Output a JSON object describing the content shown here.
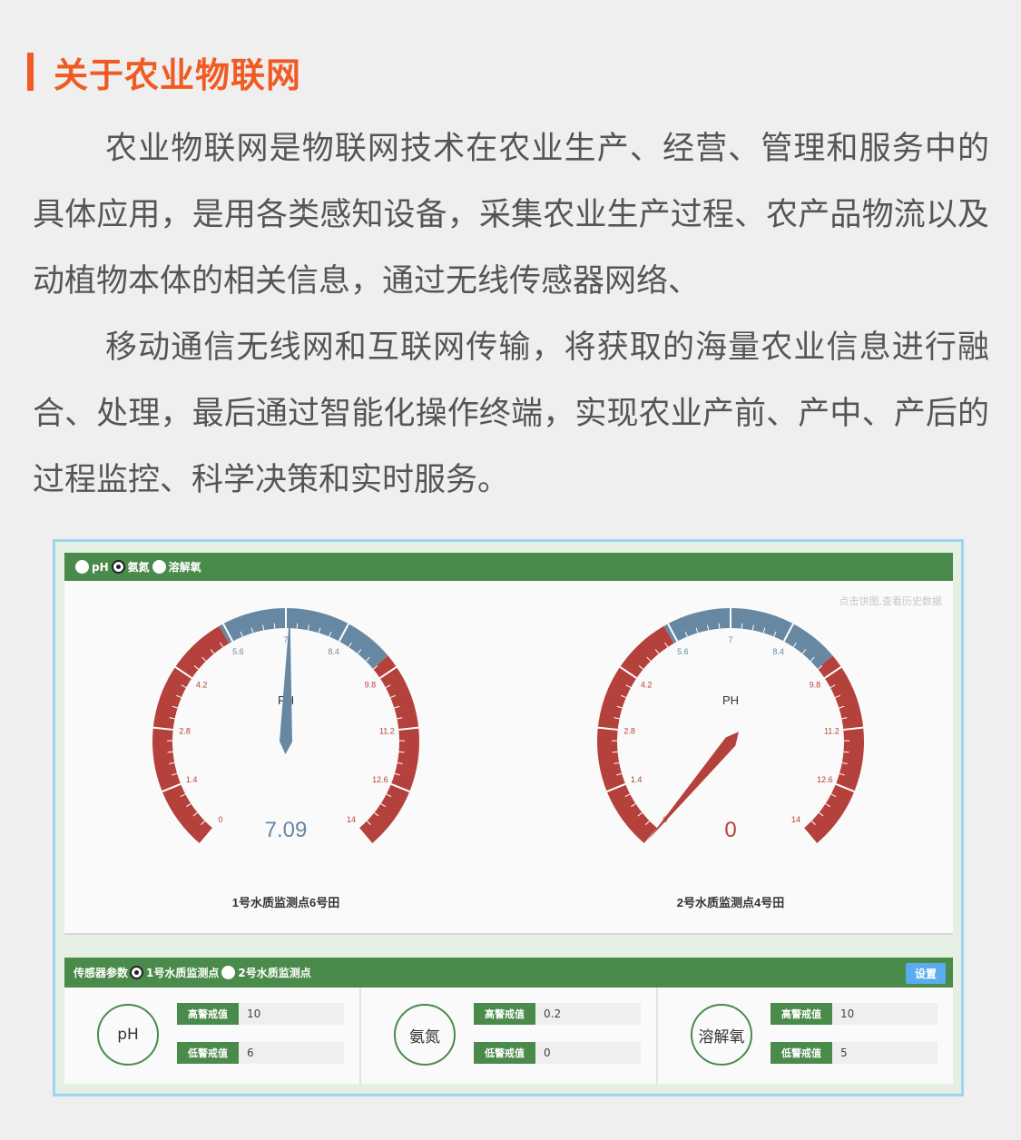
{
  "heading": {
    "title": "关于农业物联网"
  },
  "paragraphs": [
    "农业物联网是物联网技术在农业生产、经营、管理和服务中的具体应用，是用各类感知设备，采集农业生产过程、农产品物流以及动植物本体的相关信息，通过无线传感器网络、",
    "移动通信无线网和互联网传输，将获取的海量农业信息进行融合、处理，最后通过智能化操作终端，实现农业产前、产中、产后的过程监控、科学决策和实时服务。"
  ],
  "panel": {
    "selector": {
      "options": [
        {
          "label": "pH",
          "checked": false
        },
        {
          "label": "氨氮",
          "checked": true
        },
        {
          "label": "溶解氧",
          "checked": false
        }
      ]
    },
    "hint": "点击饼图,查看历史数据",
    "gauges": [
      {
        "title": "PH",
        "value": 7.09,
        "value_text": "7.09",
        "caption": "1号水质监测点6号田",
        "min": 0,
        "max": 14,
        "ticks": [
          "0",
          "1.4",
          "2.8",
          "4.2",
          "5.6",
          "7",
          "8.4",
          "9.8",
          "11.2",
          "12.6",
          "14"
        ],
        "bands": [
          {
            "from": 0,
            "to": 5.5,
            "color": "#b5413c"
          },
          {
            "from": 5.5,
            "to": 9.5,
            "color": "#6788a3"
          },
          {
            "from": 9.5,
            "to": 14,
            "color": "#b5413c"
          }
        ]
      },
      {
        "title": "PH",
        "value": 0,
        "value_text": "0",
        "caption": "2号水质监测点4号田",
        "min": 0,
        "max": 14,
        "ticks": [
          "0",
          "1.4",
          "2.8",
          "4.2",
          "5.6",
          "7",
          "8.4",
          "9.8",
          "11.2",
          "12.6",
          "14"
        ],
        "bands": [
          {
            "from": 0,
            "to": 5.5,
            "color": "#b5413c"
          },
          {
            "from": 5.5,
            "to": 9.5,
            "color": "#6788a3"
          },
          {
            "from": 9.5,
            "to": 14,
            "color": "#b5413c"
          }
        ]
      }
    ],
    "sensor": {
      "label": "传感器参数",
      "points": [
        {
          "label": "1号水质监测点",
          "checked": true
        },
        {
          "label": "2号水质监测点",
          "checked": false
        }
      ],
      "set_label": "设置",
      "params": [
        {
          "name": "pH",
          "high_label": "高警戒值",
          "high": "10",
          "low_label": "低警戒值",
          "low": "6"
        },
        {
          "name": "氨氮",
          "high_label": "高警戒值",
          "high": "0.2",
          "low_label": "低警戒值",
          "low": "0"
        },
        {
          "name": "溶解氧",
          "high_label": "高警戒值",
          "high": "10",
          "low_label": "低警戒值",
          "low": "5"
        }
      ]
    },
    "colors": {
      "green": "#4a8a4a",
      "red": "#b5413c",
      "blue": "#6788a3",
      "accent": "#f15a22"
    }
  }
}
